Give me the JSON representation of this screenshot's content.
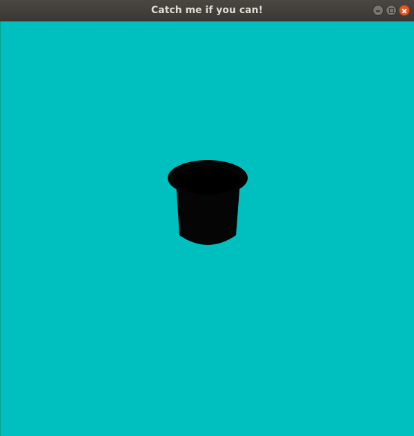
{
  "window": {
    "title": "Catch me if you can!",
    "controls": {
      "minimize": "minimize-icon",
      "maximize": "maximize-icon",
      "close": "close-icon"
    }
  },
  "scene": {
    "background_color": "#00bfbf",
    "object": "bucket",
    "object_color": "#000000"
  }
}
